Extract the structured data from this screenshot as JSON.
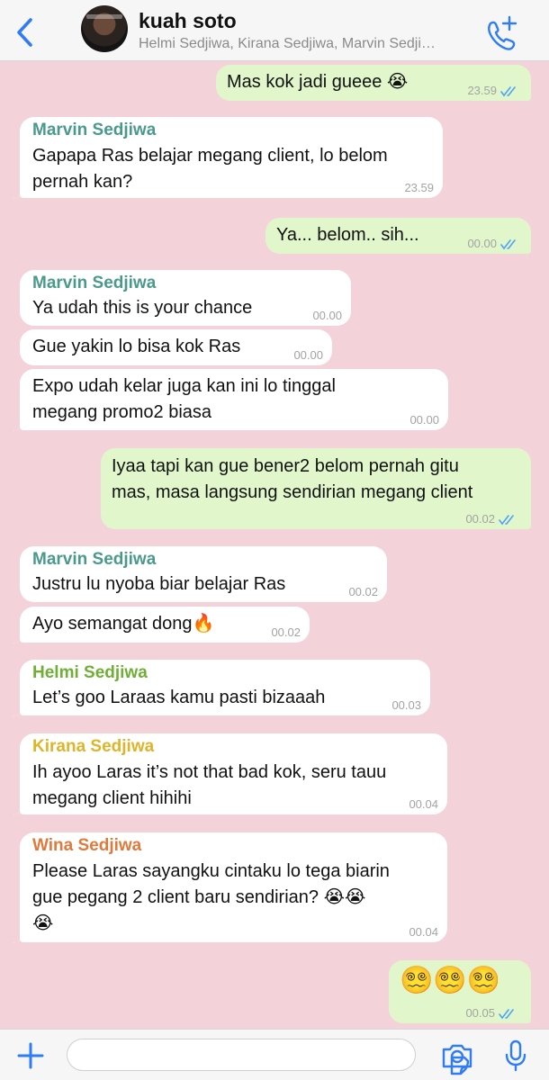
{
  "header": {
    "back_icon": "chevron-left-icon",
    "title": "kuah soto",
    "subtitle": "Helmi Sedjiwa, Kirana Sedjiwa, Marvin Sedji…",
    "call_icon": "add-call-icon",
    "accent": "#2f7cf6"
  },
  "colors": {
    "background": "#f3d3d9",
    "incoming": "#ffffff",
    "outgoing": "#e1f7cb",
    "read_checks": "#4fa3f7",
    "marvin": "#4a9a8c",
    "helmi": "#6faf35",
    "kirana": "#e0b42a",
    "wina": "#df7a3c"
  },
  "messages": [
    {
      "text": "Mas kok jadi gueee 😭",
      "time": "23.59"
    },
    {
      "sender": "Marvin Sedjiwa",
      "line1": "Gapapa Ras belajar megang client, lo belom",
      "line2": "pernah kan?",
      "time": "23.59"
    },
    {
      "text": "Ya... belom.. sih...",
      "time": "00.00"
    },
    {
      "sender": "Marvin Sedjiwa",
      "text": "Ya udah this is your chance",
      "time": "00.00"
    },
    {
      "text": "Gue yakin lo bisa kok Ras",
      "time": "00.00"
    },
    {
      "line1": "Expo udah kelar juga kan ini lo tinggal",
      "line2": "megang promo2 biasa",
      "time": "00.00"
    },
    {
      "line1": "Iyaa tapi kan gue bener2 belom pernah gitu",
      "line2": "mas, masa langsung sendirian megang client",
      "time": "00.02"
    },
    {
      "sender": "Marvin Sedjiwa",
      "text": "Justru lu nyoba biar belajar Ras",
      "time": "00.02"
    },
    {
      "text": "Ayo semangat dong🔥",
      "time": "00.02"
    },
    {
      "sender": "Helmi Sedjiwa",
      "text": "Let’s goo Laraas kamu pasti bizaaah",
      "time": "00.03"
    },
    {
      "sender": "Kirana Sedjiwa",
      "line1": "Ih ayoo Laras it’s not that bad kok, seru tauu",
      "line2": "megang client hihihi",
      "time": "00.04"
    },
    {
      "sender": "Wina Sedjiwa",
      "line1": "Please Laras sayangku cintaku lo tega biarin",
      "line2": "gue pegang 2 client baru sendirian? 😭😭",
      "line3": "😭",
      "time": "00.04"
    },
    {
      "text": "😵‍💫😵‍💫😵‍💫",
      "time": "00.05"
    }
  ],
  "input_bar": {
    "plus_icon": "plus-icon",
    "message_placeholder": "",
    "sticker_icon": "sticker-icon",
    "camera_icon": "camera-icon",
    "mic_icon": "microphone-icon"
  }
}
